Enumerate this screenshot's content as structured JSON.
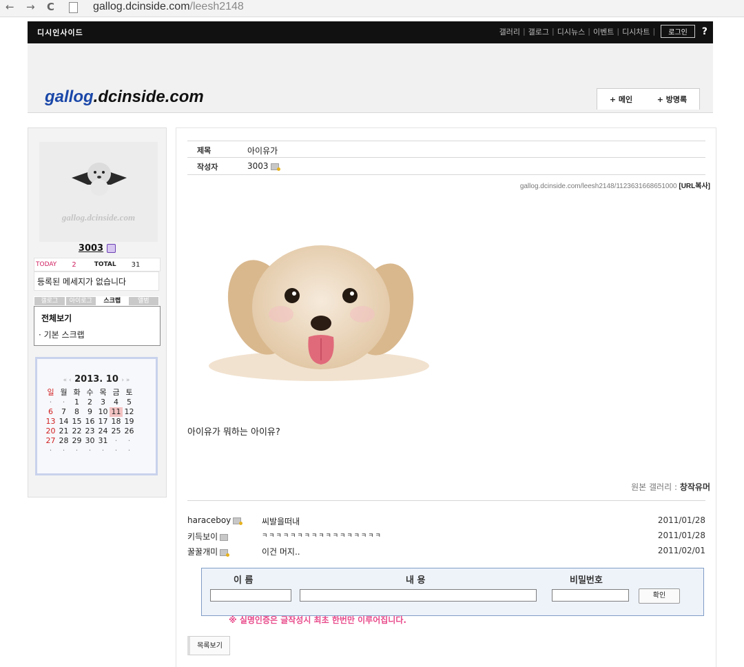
{
  "browser": {
    "back": "←",
    "forward": "→",
    "reload": "C",
    "url_host": "gallog.dcinside.com",
    "url_path": "/leesh2148"
  },
  "topbar": {
    "site_title": "디시인사이드",
    "nav": [
      "갤러리",
      "갤로그",
      "디시뉴스",
      "이벤트",
      "디시차트"
    ],
    "login_label": "로그인",
    "help": "?"
  },
  "banner": {
    "logo_prefix": "gallog",
    "logo_suffix": ".dcinside.com",
    "tabs": [
      "+ 메인",
      "+ 방명록"
    ]
  },
  "sidebar": {
    "profile_watermark": "gallog.dcinside.com",
    "username": "3003",
    "today_label": "TODAY",
    "today_count": "2",
    "total_label": "TOTAL",
    "total_count": "31",
    "message": "등록된 메세지가 없습니다",
    "tabs": [
      "갤로그",
      "아이로그",
      "스크랩",
      "앨범"
    ],
    "scrap_all": "전체보기",
    "scrap_basic": "· 기본 스크랩"
  },
  "calendar": {
    "year_month": "2013. 10",
    "prev": "« ‹",
    "next": "› »",
    "weekdays": [
      "일",
      "월",
      "화",
      "수",
      "목",
      "금",
      "토"
    ],
    "weeks": [
      [
        "·",
        "·",
        "1",
        "2",
        "3",
        "4",
        "5"
      ],
      [
        "6",
        "7",
        "8",
        "9",
        "10",
        "11",
        "12"
      ],
      [
        "13",
        "14",
        "15",
        "16",
        "17",
        "18",
        "19"
      ],
      [
        "20",
        "21",
        "22",
        "23",
        "24",
        "25",
        "26"
      ],
      [
        "27",
        "28",
        "29",
        "30",
        "31",
        "·",
        "·"
      ],
      [
        "·",
        "·",
        "·",
        "·",
        "·",
        "·",
        "·"
      ]
    ],
    "today": "11"
  },
  "post": {
    "title_label": "제목",
    "title": "아이유가",
    "author_label": "작성자",
    "author": "3003",
    "url_text": "gallog.dcinside.com/leesh2148/1123631668651000",
    "url_copy": "[URL복사]",
    "body": "아이유가 뭐하는 아이유?",
    "origin_label": "원본 갤러리 :",
    "origin_name": "창작유머"
  },
  "comments": [
    {
      "name": "haraceboy",
      "icon": "gold",
      "text": "씨발을떠내",
      "date": "2011/01/28"
    },
    {
      "name": "키득보이",
      "icon": "plain",
      "text": "ㅋㅋㅋㅋㅋㅋㅋㅋㅋㅋㅋㅋㅋㅋㅋㅋㅋ",
      "date": "2011/01/28"
    },
    {
      "name": "꿀꿀개미",
      "icon": "gold",
      "text": "이건 머지..",
      "date": "2011/02/01"
    }
  ],
  "comment_form": {
    "name_label": "이 름",
    "content_label": "내 용",
    "password_label": "비밀번호",
    "confirm_label": "확인",
    "notice": "※ 실명인증은 글작성시 최초 한번만 이루어집니다."
  },
  "list_button": "목록보기"
}
